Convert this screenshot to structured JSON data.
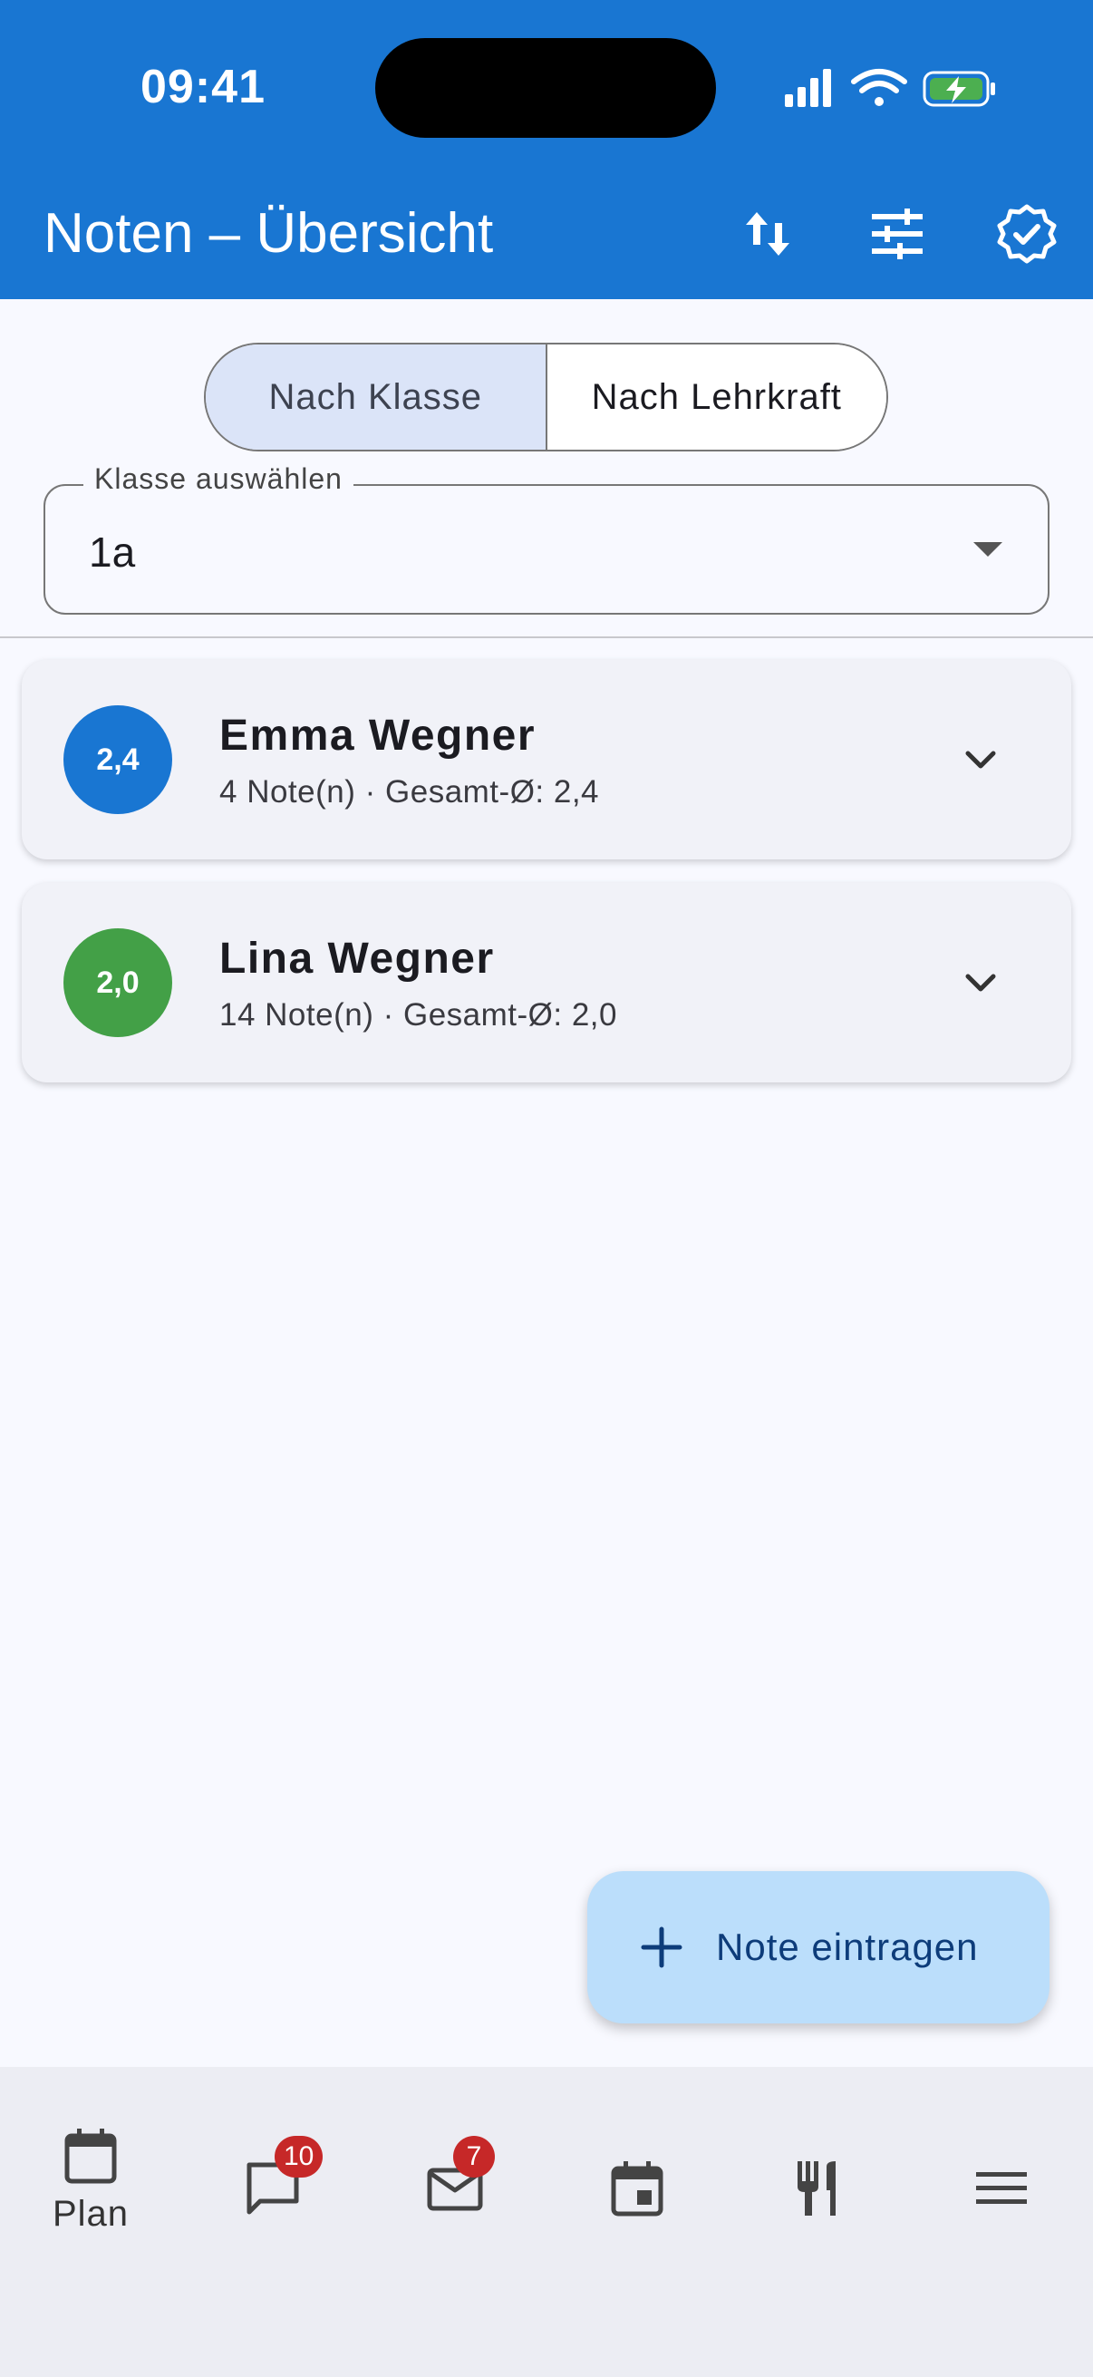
{
  "status": {
    "time": "09:41"
  },
  "header": {
    "title": "Noten – Übersicht"
  },
  "segmented": {
    "option1": "Nach Klasse",
    "option2": "Nach Lehrkraft"
  },
  "class_select": {
    "label": "Klasse auswählen",
    "value": "1a"
  },
  "students": [
    {
      "name": "Emma Wegner",
      "average": "2,4",
      "summary": "4 Note(n) · Gesamt-Ø: 2,4",
      "color": "#1976d2"
    },
    {
      "name": "Lina Wegner",
      "average": "2,0",
      "summary": "14 Note(n) · Gesamt-Ø: 2,0",
      "color": "#43a047"
    }
  ],
  "fab": {
    "label": "Note eintragen"
  },
  "bottom_nav": {
    "plan_label": "Plan",
    "chat_badge": "10",
    "mail_badge": "7"
  },
  "colors": {
    "primary": "#1976d2",
    "badge": "#c62828",
    "fab": "#bbdefb"
  }
}
